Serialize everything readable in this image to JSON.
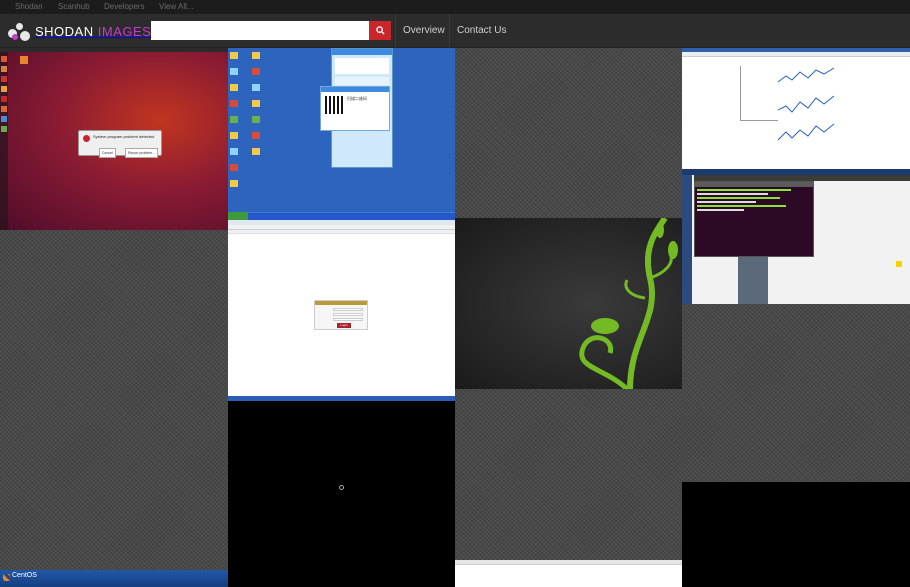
{
  "topnav": {
    "items": [
      {
        "label": "Shodan"
      },
      {
        "label": "Scanhub"
      },
      {
        "label": "Developers"
      },
      {
        "label": "View All..."
      }
    ]
  },
  "header": {
    "brand_primary": "Shodan",
    "brand_secondary": "Images",
    "search": {
      "value": "",
      "placeholder": ""
    },
    "search_icon": "search-icon",
    "nav": [
      {
        "label": "Overview"
      },
      {
        "label": "Contact Us"
      }
    ]
  },
  "colors": {
    "accent": "#c8262a",
    "brand_secondary": "#c53bcc",
    "header_bg": "#2c2c2c",
    "topbar_bg": "#1c1c1c"
  },
  "tiles": [
    {
      "name": "ubuntu-desktop",
      "dialog_title": "System program problem detected",
      "dialog_buttons": [
        "Cancel",
        "Report problem..."
      ]
    },
    {
      "name": "windows-xp-desktop",
      "popup_title": "QQ2013",
      "qr_caption": "扫描二维码"
    },
    {
      "name": "pattern-tile"
    },
    {
      "name": "chart-app-window"
    },
    {
      "name": "pattern-tile"
    },
    {
      "name": "browser-login-page",
      "login_button": "Login"
    },
    {
      "name": "opensuse-wallpaper"
    },
    {
      "name": "terminal-desktop"
    },
    {
      "name": "pattern-tile"
    },
    {
      "name": "black-screen"
    },
    {
      "name": "pattern-tile"
    },
    {
      "name": "black-screen"
    },
    {
      "name": "centos-desktop",
      "brand": "CentOS"
    },
    {
      "name": "white-window"
    }
  ]
}
